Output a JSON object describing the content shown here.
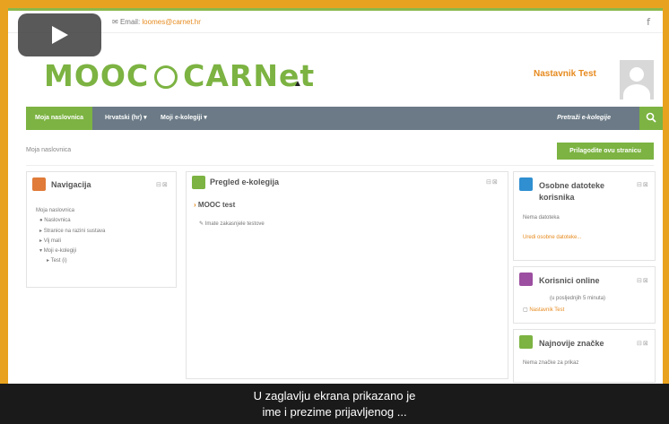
{
  "header": {
    "contact": "Email:",
    "email": "loomes@carnet.hr",
    "fb_icon": "f",
    "logo_left": "MOOC",
    "logo_right": "CARNet",
    "user_name": "Nastavnik Test"
  },
  "nav": {
    "home": "Moja naslovnica",
    "language": "Hrvatski (hr) ▾",
    "courses": "Moji e-kolegiji ▾",
    "search_link": "Pretraži e-kolegije"
  },
  "breadcrumb": "Moja naslovnica",
  "customize_button": "Prilagodite ovu stranicu",
  "navigation_block": {
    "title": "Navigacija",
    "items": [
      "Moja naslovnica",
      "Naslovnica",
      "Stranice na razini sustava",
      "Vij mali",
      "Moji e-kolegiji",
      "Test (i)"
    ]
  },
  "overview_block": {
    "title": "Pregled e-kolegija",
    "course": "MOOC test",
    "activity": "Imate zakasnjele testove"
  },
  "files_block": {
    "title": "Osobne datoteke korisnika",
    "empty": "Nema datoteka",
    "link": "Uredi osobne datoteke..."
  },
  "online_block": {
    "title": "Korisnici online",
    "info": "(u posljednjih 5 minuta)",
    "user": "Nastavnik Test"
  },
  "badges_block": {
    "title": "Najnovije značke",
    "empty": "Nema značke za prikaz"
  },
  "caption": {
    "line1": "U zaglavlju ekrana prikazano je",
    "line2": "ime i prezime prijavljenog ..."
  },
  "colors": {
    "accent": "#7cb342",
    "orange": "#e68a1e",
    "nav": "#6b7a86",
    "frame": "#e9a21f"
  }
}
